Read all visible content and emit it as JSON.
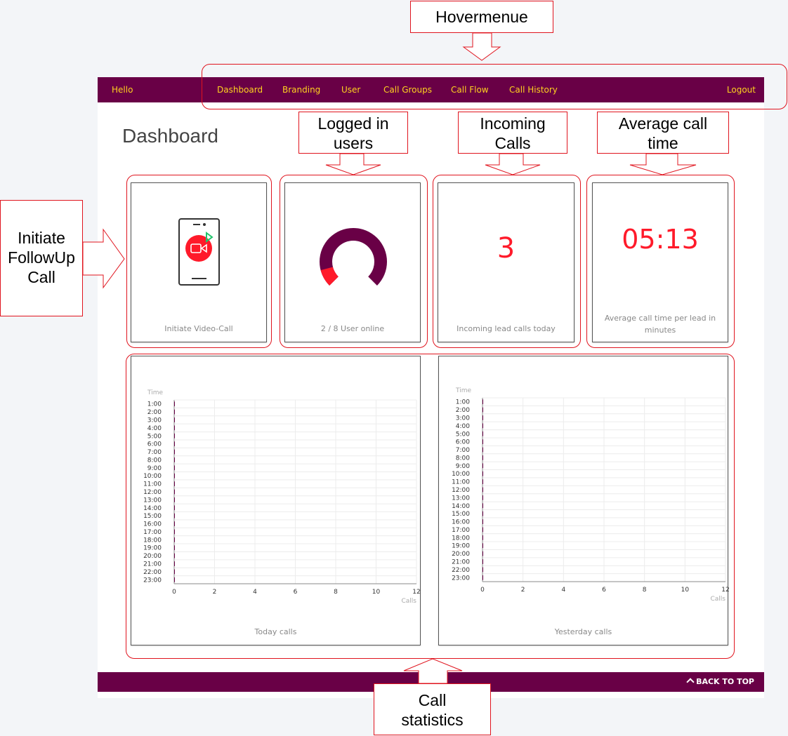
{
  "navbar": {
    "greeting": "Hello",
    "items": [
      "Dashboard",
      "Branding",
      "User",
      "Call Groups",
      "Call Flow",
      "Call History"
    ],
    "logout": "Logout"
  },
  "page": {
    "title": "Dashboard"
  },
  "cards": {
    "video_call": {
      "label": "Initiate Video-Call"
    },
    "users_online": {
      "label": "2 / 8 User online",
      "online": 2,
      "total": 8
    },
    "incoming": {
      "value": "3",
      "label": "Incoming lead calls today"
    },
    "avg_time": {
      "value": "05:13",
      "label": "Average call time per lead in minutes"
    }
  },
  "footer": {
    "back_to_top": "BACK TO TOP"
  },
  "annotations": {
    "hovermenu": "Hovermenue",
    "logged_in": [
      "Logged in",
      "users"
    ],
    "incoming_calls": [
      "Incoming",
      "Calls"
    ],
    "average_call": [
      "Average call",
      "time"
    ],
    "initiate_followup": [
      "Initiate",
      "FollowUp",
      "Call"
    ],
    "call_statistics": [
      "Call",
      "statistics"
    ]
  },
  "colors": {
    "brand": "#690046",
    "nav_text": "#ffd21f",
    "accent_red": "#ff1a2a",
    "annotation": "#e0141e"
  },
  "chart_data": [
    {
      "type": "bar",
      "orientation": "horizontal",
      "title": "Today calls",
      "ylabel": "Time",
      "xlabel": "Calls",
      "categories": [
        "1:00",
        "2:00",
        "3:00",
        "4:00",
        "5:00",
        "6:00",
        "7:00",
        "8:00",
        "9:00",
        "10:00",
        "11:00",
        "12:00",
        "13:00",
        "14:00",
        "15:00",
        "16:00",
        "17:00",
        "18:00",
        "19:00",
        "20:00",
        "21:00",
        "22:00",
        "23:00"
      ],
      "values": [
        0,
        0,
        0,
        0,
        0,
        0,
        0,
        0,
        0,
        0,
        0,
        0,
        0,
        0,
        0,
        0,
        0,
        0,
        0,
        0,
        0,
        0,
        0
      ],
      "xlim": [
        0,
        12
      ],
      "xticks": [
        "0",
        "2",
        "4",
        "6",
        "8",
        "10",
        "12"
      ]
    },
    {
      "type": "bar",
      "orientation": "horizontal",
      "title": "Yesterday calls",
      "ylabel": "Time",
      "xlabel": "Calls",
      "categories": [
        "1:00",
        "2:00",
        "3:00",
        "4:00",
        "5:00",
        "6:00",
        "7:00",
        "8:00",
        "9:00",
        "10:00",
        "11:00",
        "12:00",
        "13:00",
        "14:00",
        "15:00",
        "16:00",
        "17:00",
        "18:00",
        "19:00",
        "20:00",
        "21:00",
        "22:00",
        "23:00"
      ],
      "values": [
        0,
        0,
        0,
        0,
        0,
        0,
        0,
        0,
        0,
        0,
        0,
        0,
        0,
        0,
        0,
        0,
        0,
        0,
        0,
        0,
        0,
        0,
        0
      ],
      "xlim": [
        0,
        12
      ],
      "xticks": [
        "0",
        "2",
        "4",
        "6",
        "8",
        "10",
        "12"
      ]
    }
  ]
}
